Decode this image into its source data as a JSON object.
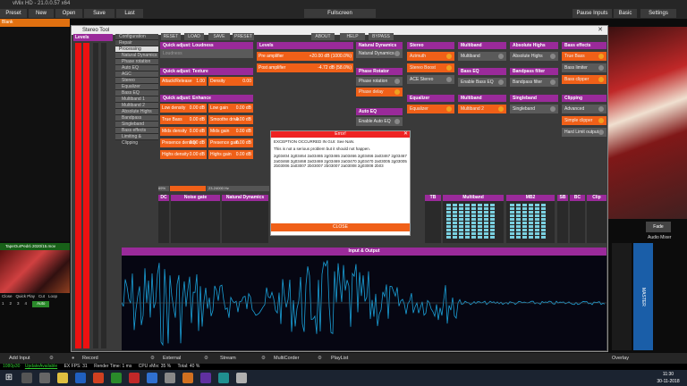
{
  "vmix": {
    "title": "vMix HD - 21.0.0.57 x64",
    "buttons": {
      "preset": "Preset",
      "new": "New",
      "open": "Open",
      "save": "Save",
      "last": "Last",
      "fullscreen": "Fullscreen",
      "pause_inputs": "Pause Inputs",
      "basic": "Basic",
      "settings": "Settings"
    },
    "left_label": "Blank",
    "input_name": "TapeOurPeds\\ 2020/15.mov",
    "input_buttons": [
      "Close",
      "Quick Play",
      "Cut",
      "Loop"
    ],
    "input_numbers": [
      "1",
      "2",
      "3",
      "4"
    ],
    "audio_label": "Auto",
    "right": {
      "fade": "Fade",
      "audio_mixer": "Audio Mixer",
      "master": "MASTER"
    }
  },
  "stereo": {
    "title": "Stereo Tool",
    "levels": "Levels",
    "menu": [
      "Configuration",
      "Repair",
      "Processing",
      "Natural Dynamics",
      "Phase rotation",
      "Auto EQ",
      "AGC",
      "Stereo",
      "Equalizer",
      "Bass EQ",
      "Multiband 1",
      "Multiband 2",
      "Absolute Highs",
      "Bandpass",
      "Singleband",
      "Bass effects",
      "Limiting & Clipping"
    ],
    "topbuttons": [
      "RESET",
      "LOAD",
      "SAVE",
      "PRESET",
      "ABOUT",
      "HELP",
      "BYPASS"
    ],
    "loud": {
      "head": "Quick adjust: Loudness",
      "row": "Loudness"
    },
    "texture": {
      "head": "Quick adjust: Texture",
      "attack": "Attack/Release",
      "attack_v": "1.00",
      "density": "Density",
      "density_v": "0.00"
    },
    "enhance": {
      "head": "Quick adjust: Enhance",
      "rows": [
        [
          "Low density",
          "0.00 dB",
          "Low gain",
          "0.00 dB"
        ],
        [
          "True Bass",
          "0.00 dB",
          "Smoothe drive",
          "0.00 dB"
        ],
        [
          "Mids density",
          "0.00 dB",
          "Mids gain",
          "0.00 dB"
        ],
        [
          "Presence density",
          "0.00 dB",
          "Presence gain",
          "0.00 dB"
        ],
        [
          "Highs density",
          "0.00 dB",
          "Highs gain",
          "0.00 dB"
        ]
      ]
    },
    "levels_panel": {
      "head": "Levels",
      "pre": "Pre amplifier",
      "pre_v": "+20.00 dB (1000.0%)",
      "post": "Post amplifier",
      "post_v": "-4.72 dB (58.0%)"
    },
    "natural": {
      "head": "Natural Dynamics",
      "row": "Natural Dynamics"
    },
    "phase": {
      "head": "Phase Rotator",
      "rows": [
        "Phase rotation",
        "Phase delay"
      ]
    },
    "autoeq": {
      "head": "Auto EQ",
      "row": "Enable Auto EQ"
    },
    "stereo_p": {
      "head": "Stereo",
      "rows": [
        "Azimuth",
        "Stereo Boost",
        "ACE Stereo"
      ]
    },
    "equalizer": {
      "head": "Equalizer",
      "row": "Equalizer"
    },
    "multiband": {
      "head": "Multiband",
      "row": "Multiband"
    },
    "basseq": {
      "head": "Bass EQ",
      "row": "Enable Bass EQ"
    },
    "multiband2": {
      "head": "Multiband",
      "row": "Multiband 2"
    },
    "abshighs": {
      "head": "Absolute Highs",
      "row": "Absolute Highs"
    },
    "bandpass": {
      "head": "Bandpass filter",
      "row": "Bandpass filter"
    },
    "singleband": {
      "head": "Singleband",
      "row": "Singleband"
    },
    "basseff": {
      "head": "Bass effects",
      "rows": [
        "True Bass",
        "Bass limiter",
        "Bass clipper"
      ]
    },
    "clipping": {
      "head": "Clipping",
      "rows": [
        "Advanced",
        "Simple clipper",
        "Hard Limit output"
      ]
    },
    "sections": [
      "DC",
      "Noise gate",
      "Natural Dynamics",
      "TB",
      "Multiband",
      "MB2",
      "SB",
      "BC",
      "Clip"
    ],
    "freq": "23-24000 Hz",
    "pct": "69%",
    "io": "Input & Output"
  },
  "error": {
    "title": "Error!",
    "msg1": "EXCEPTION OCCURRED IN GUI: See NaN.",
    "msg2": "This is not a serious problem but it should not happen.",
    "hex": "2g03404 2g03464 2a03465 2g03465 2a03466 2g03466 2a03467 2g03467 2a03468 2g03468 2a03469 2g03469 2a03470 2g03470 2a03005 2g03005 2b03006 2a03007 2b03007 2b03007 2a03008 2g03008 2b03",
    "close": "CLOSE"
  },
  "bottom": {
    "add_input": "Add Input",
    "record": "Record",
    "external": "External",
    "stream": "Stream",
    "multicorder": "MultiCorder",
    "playlist": "PlayList",
    "overlay": "Overlay"
  },
  "status": {
    "res": "1080p30",
    "update": "UpdateAvailable",
    "fps": "EX FPS: 31",
    "render": "Render Time: 1 ms",
    "cpu": "CPU vMix: 35 %",
    "total": "Total: 40 %"
  },
  "clock": {
    "time": "11:30",
    "date": "30-11-2018"
  }
}
